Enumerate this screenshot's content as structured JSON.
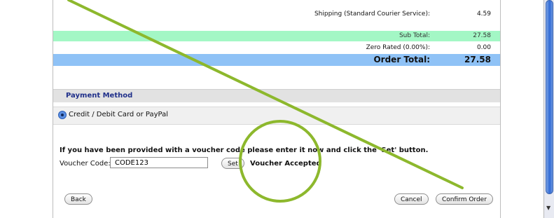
{
  "summary": {
    "shipping_label": "Shipping (Standard Courier Service):",
    "shipping_value": "4.59",
    "subtotal_label": "Sub Total:",
    "subtotal_value": "27.58",
    "zero_rated_label": "Zero Rated (0.00%):",
    "zero_rated_value": "0.00",
    "order_total_label": "Order Total:",
    "order_total_value": "27.58"
  },
  "payment": {
    "header": "Payment Method",
    "option_label": "Credit / Debit Card or PayPal",
    "selected": true
  },
  "voucher": {
    "instructions": "If you have been provided with a voucher code please enter it now and click the 'Set' button.",
    "label": "Voucher Code:",
    "value": "CODE123",
    "set_button": "Set",
    "status": "Voucher Accepted"
  },
  "actions": {
    "back": "Back",
    "cancel": "Cancel",
    "confirm": "Confirm Order"
  },
  "colors": {
    "subtotal_bg": "#a3f7c5",
    "order_total_bg": "#8fc2f6",
    "annotation": "#8db82d"
  }
}
